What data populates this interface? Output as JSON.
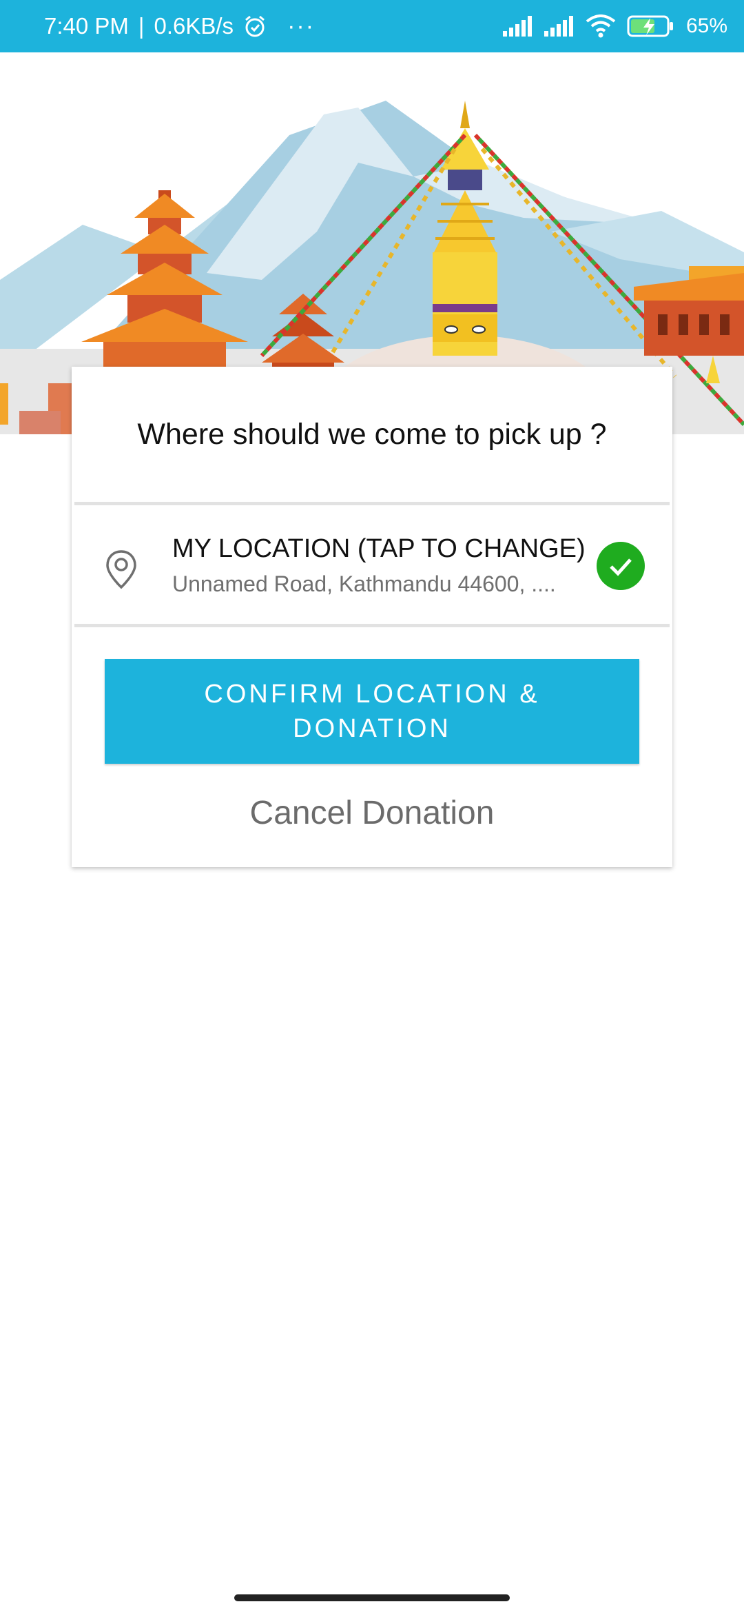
{
  "status_bar": {
    "time": "7:40 PM",
    "speed": "0.6KB/s",
    "more": "···",
    "battery": "65%",
    "icons": [
      "alarm-icon",
      "signal-icon",
      "signal-icon",
      "wifi-icon",
      "battery-charging-icon"
    ]
  },
  "banner": {
    "description_icons": [
      "mountain-illustration",
      "stupa-illustration",
      "pagoda-illustration"
    ]
  },
  "pickup": {
    "question": "Where should we come to pick up ?",
    "location_title": "MY LOCATION (TAP TO CHANGE)",
    "location_address": "Unnamed Road, Kathmandu 44600, ....",
    "confirm_label": "CONFIRM LOCATION & DONATION",
    "cancel_label": "Cancel Donation"
  },
  "colors": {
    "accent": "#1db3dc",
    "check": "#1fac1f",
    "text_secondary": "#6b6b6b"
  }
}
